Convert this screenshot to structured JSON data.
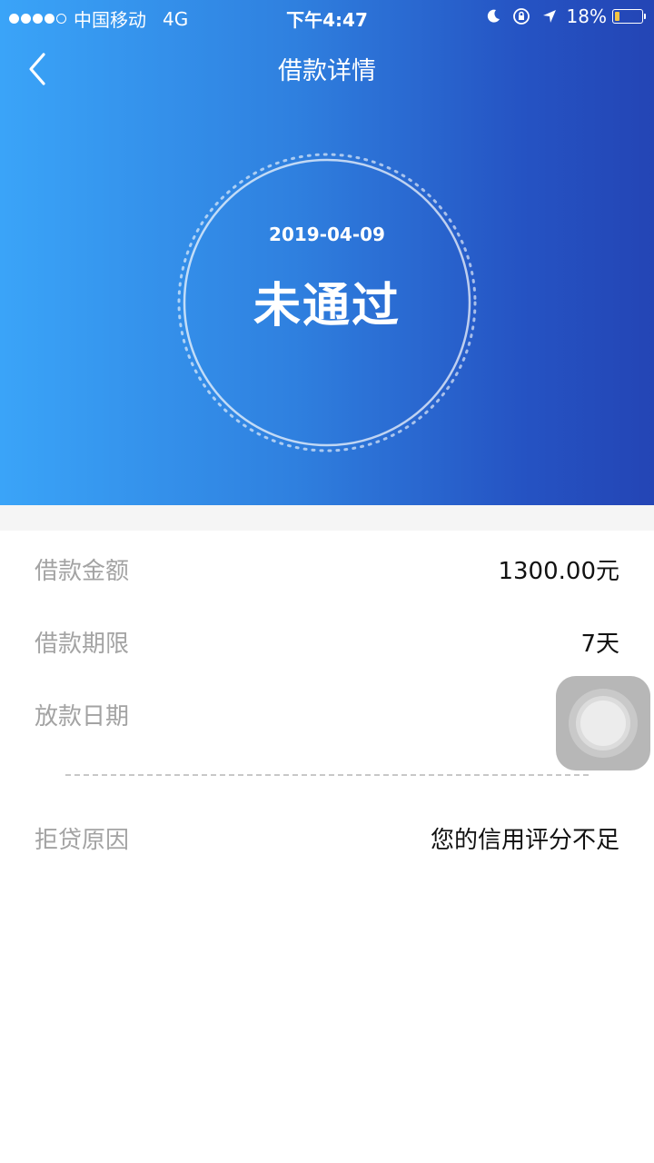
{
  "status_bar": {
    "carrier": "中国移动",
    "network": "4G",
    "time": "下午4:47",
    "battery_percent": "18%",
    "battery_level": 0.18,
    "icons": [
      "moon-icon",
      "rotation-lock-icon",
      "location-arrow-icon",
      "battery-icon"
    ]
  },
  "nav": {
    "title": "借款详情",
    "back_icon": "chevron-left-icon"
  },
  "status_card": {
    "date": "2019-04-09",
    "status": "未通过"
  },
  "details": {
    "loan_amount": {
      "label": "借款金额",
      "value": "1300.00元"
    },
    "loan_term": {
      "label": "借款期限",
      "value": "7天"
    },
    "disbursement_date": {
      "label": "放款日期",
      "value": ""
    },
    "rejection_reason": {
      "label": "拒贷原因",
      "value": "您的信用评分不足"
    }
  },
  "colors": {
    "gradient_start": "#3aa4f8",
    "gradient_end": "#2445b5",
    "label_gray": "#a3a3a3",
    "value_black": "#111111"
  }
}
